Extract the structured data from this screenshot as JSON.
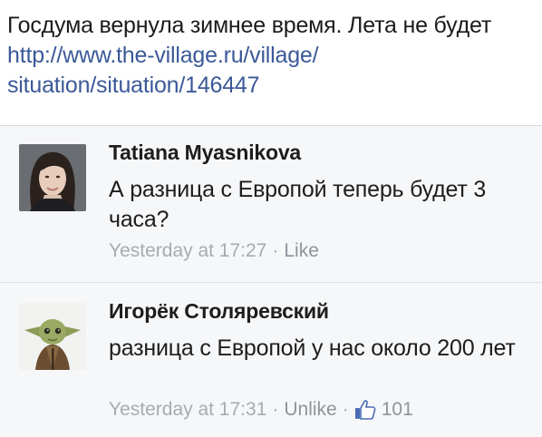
{
  "post": {
    "text": "Госдума вернула зимнее время. Лета не будет",
    "link_line1": "http://www.the-village.ru/village/",
    "link_line2": "situation/situation/146447"
  },
  "comments": [
    {
      "author": "Tatiana Myasnikova",
      "text": "А разница с Европой теперь будет 3 часа?",
      "time": "Yesterday at 17:27",
      "separator": "·",
      "action": "Like",
      "avatar_icon": "woman-portrait-avatar"
    },
    {
      "author": "Игорёк Столяревский",
      "text": "разница с Европой у нас около 200 лет",
      "time": "Yesterday at 17:31",
      "separator": "·",
      "action": "Unlike",
      "separator2": "·",
      "likes": "101",
      "avatar_icon": "yoda-avatar",
      "like_icon": "thumbs-up-icon"
    }
  ],
  "colors": {
    "link": "#3b5998",
    "meta": "#a7abb1",
    "background": "#f6f7f9",
    "like_blue": "#4a6cb3"
  }
}
